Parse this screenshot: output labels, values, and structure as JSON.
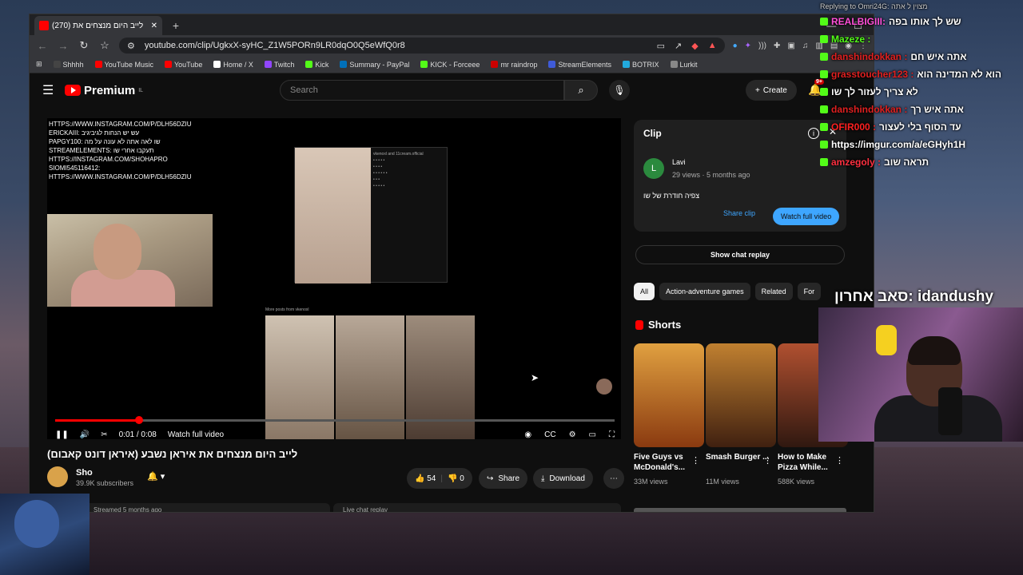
{
  "browser": {
    "tab_title": "לייב היום מנצחים את (270)",
    "url": "youtube.com/clip/UgkxX-syHC_Z1W5PORn9LR0dqO0Q5eWfQ0r8",
    "bookmarks": [
      "Shhhh",
      "YouTube Music",
      "YouTube",
      "Home / X",
      "Twitch",
      "Kick",
      "Summary - PayPal",
      "KICK - Forceee",
      "mr raindrop",
      "StreamElements",
      "BOTRIX",
      "Lurkit"
    ],
    "bookmark_colors": [
      "#444",
      "#f00",
      "#f00",
      "#fff",
      "#9146ff",
      "#53fc18",
      "#0070ba",
      "#53fc18",
      "#c00",
      "#3f5bd8",
      "#2ad",
      "#888"
    ]
  },
  "youtube": {
    "logo": "Premium",
    "logo_sup": "IL",
    "search_placeholder": "Search",
    "create_label": "Create",
    "notif_badge": "9+",
    "video_title": "לייב היום מנצחים את איראן נשבע (איראן דונט קאבום)",
    "channel": "Sho",
    "subscribers": "39.9K subscribers",
    "likes": "54",
    "dislikes": "0",
    "share_label": "Share",
    "download_label": "Download",
    "streamed": "Streamed 5 months ago",
    "live_chat_replay": "Live chat replay",
    "player": {
      "time": "0:01 / 0:08",
      "watch_full": "Watch full video",
      "progress": 0.15,
      "chat_lines": [
        "HTTPS://WWW.INSTAGRAM.COM/P/DLH56DZIU",
        "ERICKAIII: עש יש הנחות לגיביגיב",
        "PAPGY100: שו לאה אתה לא עונה על מה",
        "STREAMELEMENTS: תעקבו אחרי שו",
        "HTTPS://INSTAGRAM.COM/SHOHAPRO",
        "SIOMI545116412:",
        "HTTPS://WWW.INSTAGRAM.COM/P/DLH56DZIU"
      ],
      "more_posts": "More posts from vkenoxl"
    },
    "clip": {
      "heading": "Clip",
      "author": "Lavi",
      "author_initial": "L",
      "meta": "29 views · 5 months ago",
      "desc": "צפיה חודרת של שו",
      "share_label": "Share clip",
      "watch_label": "Watch full video"
    },
    "show_chat_replay": "Show chat replay",
    "chips": [
      "All",
      "Action-adventure games",
      "Related",
      "For"
    ],
    "shorts_heading": "Shorts",
    "shorts": [
      {
        "title": "Five Guys vs McDonald's...",
        "views": "33M views",
        "c1": "#e0a040",
        "c2": "#8a3a10"
      },
      {
        "title": "Smash Burger ...",
        "views": "11M views",
        "c1": "#c08030",
        "c2": "#402010"
      },
      {
        "title": "How to Make Pizza While...",
        "views": "588K views",
        "c1": "#b05030",
        "c2": "#301810"
      }
    ]
  },
  "stream_overlay": {
    "replying": "Replying to Omri24G: מצוין ל אתה",
    "lines": [
      {
        "user": "REALBIGIII:",
        "text": "שש לך אותו בפה",
        "color": "#ff4fd8"
      },
      {
        "user": "Mazeze :",
        "text": "",
        "color": "#53fc18"
      },
      {
        "user": "danshindokkan :",
        "text": "אתה איש חם",
        "color": "#e02020"
      },
      {
        "user": "grasstoucher123 :",
        "text": "הוא לא המדינה הוא",
        "color": "#e02020"
      },
      {
        "user": "",
        "text": "לא צריך לעזור לך שו",
        "color": "#fff"
      },
      {
        "user": "danshindokkan :",
        "text": "אתה איש רך",
        "color": "#e02020"
      },
      {
        "user": "OFIR000 :",
        "text": "עד הסוף בלי לעצור",
        "color": "#ff2020"
      },
      {
        "user": "",
        "text": "https://imgur.com/a/eGHyh1H",
        "color": "#fff"
      },
      {
        "user": "amzegoly :",
        "text": "תראה שוב",
        "color": "#ff3040"
      }
    ],
    "last_sub": "סאב אחרון: idandushy"
  }
}
